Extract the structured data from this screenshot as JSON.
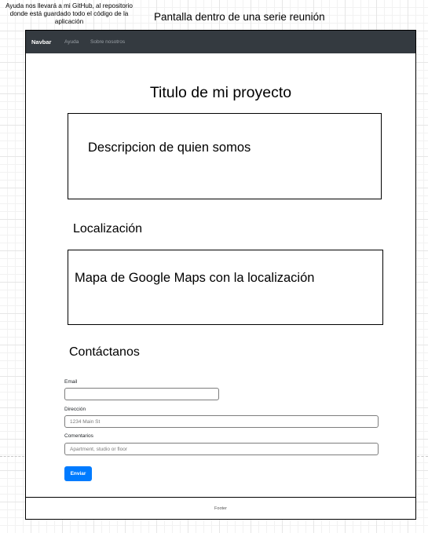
{
  "annotations": {
    "help_note": "Ayuda nos llevará a mi GitHub, al repositorio donde está guardado todo el código de la aplicación",
    "screen_note": "Pantalla dentro de una serie reunión"
  },
  "navbar": {
    "brand": "Navbar",
    "links": [
      "Ayuda",
      "Sobre nosotros"
    ]
  },
  "main": {
    "title": "Titulo de mi proyecto",
    "description_box": "Descripcion de quien somos",
    "location_heading": "Localización",
    "map_box": "Mapa de Google Maps con la localización",
    "contact_heading": "Contáctanos"
  },
  "form": {
    "email_label": "Email",
    "email_value": "",
    "address_label": "Dirección",
    "address_placeholder": "1234 Main St",
    "comments_label": "Comentarios",
    "comments_placeholder": "Apartment, studio or floor",
    "submit_label": "Enviar"
  },
  "footer": {
    "text": "Footer"
  },
  "colors": {
    "navbar_bg": "#343a40",
    "primary_button": "#007bff"
  }
}
